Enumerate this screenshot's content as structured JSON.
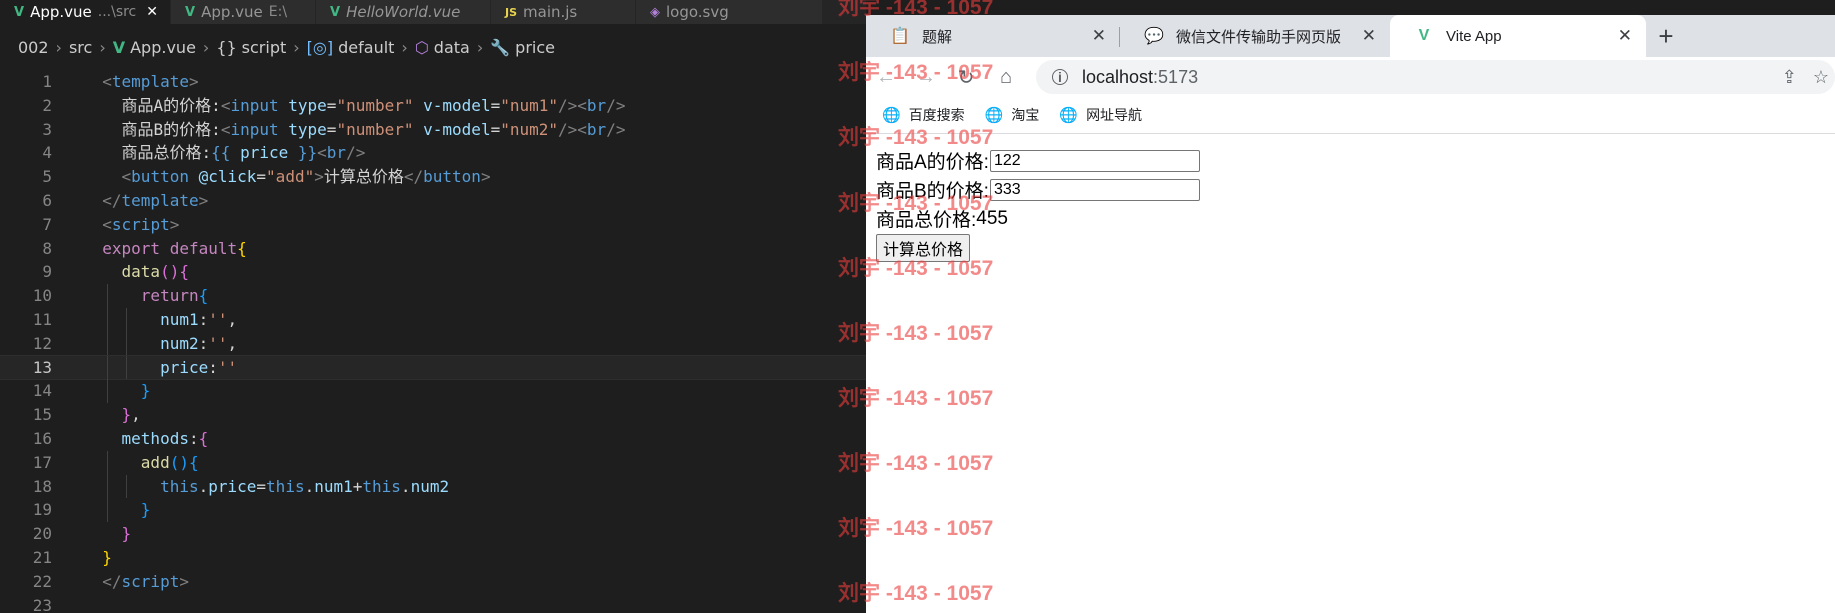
{
  "editor": {
    "tabs": [
      {
        "icon": "V",
        "label": "App.vue",
        "path": "...\\src",
        "active": true,
        "italic": false,
        "close": "✕"
      },
      {
        "icon": "V",
        "label": "App.vue",
        "path": "E:\\",
        "active": false,
        "italic": false
      },
      {
        "icon": "V",
        "label": "HelloWorld.vue",
        "path": "",
        "active": false,
        "italic": true
      },
      {
        "icon": "JS",
        "label": "main.js",
        "path": "",
        "active": false,
        "italic": false
      },
      {
        "icon": "◈",
        "label": "logo.svg",
        "path": "",
        "active": false,
        "italic": false
      }
    ],
    "breadcrumb": [
      "002",
      "src",
      "App.vue",
      "script",
      "default",
      "data",
      "price"
    ],
    "current_line": 13,
    "lines": [
      {
        "n": "1",
        "indent": 2,
        "tokens": [
          [
            "tag",
            "<"
          ],
          [
            "tagname",
            "template"
          ],
          [
            "tag",
            ">"
          ]
        ]
      },
      {
        "n": "2",
        "indent": 4,
        "tokens": [
          [
            "txt",
            "商品A的价格:"
          ],
          [
            "tag",
            "<"
          ],
          [
            "tagname",
            "input"
          ],
          [
            "txt",
            " "
          ],
          [
            "attr",
            "type"
          ],
          [
            "txt",
            "="
          ],
          [
            "str",
            "\"number\""
          ],
          [
            "txt",
            " "
          ],
          [
            "attr",
            "v-model"
          ],
          [
            "txt",
            "="
          ],
          [
            "str",
            "\"num1\""
          ],
          [
            "tag",
            "/><"
          ],
          [
            "tagname",
            "br"
          ],
          [
            "tag",
            "/>"
          ]
        ]
      },
      {
        "n": "3",
        "indent": 4,
        "tokens": [
          [
            "txt",
            "商品B的价格:"
          ],
          [
            "tag",
            "<"
          ],
          [
            "tagname",
            "input"
          ],
          [
            "txt",
            " "
          ],
          [
            "attr",
            "type"
          ],
          [
            "txt",
            "="
          ],
          [
            "str",
            "\"number\""
          ],
          [
            "txt",
            " "
          ],
          [
            "attr",
            "v-model"
          ],
          [
            "txt",
            "="
          ],
          [
            "str",
            "\"num2\""
          ],
          [
            "tag",
            "/><"
          ],
          [
            "tagname",
            "br"
          ],
          [
            "tag",
            "/>"
          ]
        ]
      },
      {
        "n": "4",
        "indent": 4,
        "tokens": [
          [
            "txt",
            "商品总价格:"
          ],
          [
            "kw2",
            "{{"
          ],
          [
            "txt",
            " "
          ],
          [
            "prop",
            "price"
          ],
          [
            "txt",
            " "
          ],
          [
            "kw2",
            "}}"
          ],
          [
            "tag",
            "<"
          ],
          [
            "tagname",
            "br"
          ],
          [
            "tag",
            "/>"
          ]
        ]
      },
      {
        "n": "5",
        "indent": 4,
        "tokens": [
          [
            "tag",
            "<"
          ],
          [
            "tagname",
            "button"
          ],
          [
            "txt",
            " "
          ],
          [
            "attr",
            "@click"
          ],
          [
            "txt",
            "="
          ],
          [
            "str",
            "\"add\""
          ],
          [
            "tag",
            ">"
          ],
          [
            "txt",
            "计算总价格"
          ],
          [
            "tag",
            "</"
          ],
          [
            "tagname",
            "button"
          ],
          [
            "tag",
            ">"
          ]
        ]
      },
      {
        "n": "6",
        "indent": 2,
        "tokens": [
          [
            "tag",
            "</"
          ],
          [
            "tagname",
            "template"
          ],
          [
            "tag",
            ">"
          ]
        ]
      },
      {
        "n": "7",
        "indent": 2,
        "tokens": [
          [
            "tag",
            "<"
          ],
          [
            "tagname",
            "script"
          ],
          [
            "tag",
            ">"
          ]
        ]
      },
      {
        "n": "8",
        "indent": 2,
        "tokens": [
          [
            "kw",
            "export"
          ],
          [
            "txt",
            " "
          ],
          [
            "kw",
            "default"
          ],
          [
            "b1",
            "{"
          ]
        ]
      },
      {
        "n": "9",
        "indent": 4,
        "tokens": [
          [
            "fn",
            "data"
          ],
          [
            "b2",
            "(){"
          ]
        ]
      },
      {
        "n": "10",
        "indent": 6,
        "tokens": [
          [
            "kw",
            "return"
          ],
          [
            "b3",
            "{"
          ]
        ]
      },
      {
        "n": "11",
        "indent": 8,
        "tokens": [
          [
            "prop",
            "num1"
          ],
          [
            "txt",
            ":"
          ],
          [
            "str",
            "''"
          ],
          [
            "txt",
            ","
          ]
        ]
      },
      {
        "n": "12",
        "indent": 8,
        "tokens": [
          [
            "prop",
            "num2"
          ],
          [
            "txt",
            ":"
          ],
          [
            "str",
            "''"
          ],
          [
            "txt",
            ","
          ]
        ]
      },
      {
        "n": "13",
        "indent": 8,
        "tokens": [
          [
            "prop",
            "price"
          ],
          [
            "txt",
            ":"
          ],
          [
            "str",
            "''"
          ]
        ]
      },
      {
        "n": "14",
        "indent": 6,
        "tokens": [
          [
            "b3",
            "}"
          ]
        ]
      },
      {
        "n": "15",
        "indent": 4,
        "tokens": [
          [
            "b2",
            "}"
          ],
          [
            "txt",
            ","
          ]
        ]
      },
      {
        "n": "16",
        "indent": 4,
        "tokens": [
          [
            "prop",
            "methods"
          ],
          [
            "txt",
            ":"
          ],
          [
            "b2",
            "{"
          ]
        ]
      },
      {
        "n": "17",
        "indent": 6,
        "tokens": [
          [
            "fn",
            "add"
          ],
          [
            "b3",
            "(){"
          ]
        ]
      },
      {
        "n": "18",
        "indent": 8,
        "tokens": [
          [
            "kw2",
            "this"
          ],
          [
            "txt",
            "."
          ],
          [
            "prop",
            "price"
          ],
          [
            "txt",
            "="
          ],
          [
            "kw2",
            "this"
          ],
          [
            "txt",
            "."
          ],
          [
            "prop",
            "num1"
          ],
          [
            "txt",
            "+"
          ],
          [
            "kw2",
            "this"
          ],
          [
            "txt",
            "."
          ],
          [
            "prop",
            "num2"
          ]
        ]
      },
      {
        "n": "19",
        "indent": 6,
        "tokens": [
          [
            "b3",
            "}"
          ]
        ]
      },
      {
        "n": "20",
        "indent": 4,
        "tokens": [
          [
            "b2",
            "}"
          ]
        ]
      },
      {
        "n": "21",
        "indent": 2,
        "tokens": [
          [
            "b1",
            "}"
          ]
        ]
      },
      {
        "n": "22",
        "indent": 2,
        "tokens": [
          [
            "tag",
            "</"
          ],
          [
            "tagname",
            "script"
          ],
          [
            "tag",
            ">"
          ]
        ]
      },
      {
        "n": "23",
        "indent": 0,
        "tokens": []
      }
    ]
  },
  "browser": {
    "tabs": [
      {
        "favicon": "📋",
        "label": "题解",
        "active": false
      },
      {
        "favicon": "💬",
        "label": "微信文件传输助手网页版",
        "active": false
      },
      {
        "favicon": "V",
        "label": "Vite App",
        "active": true
      }
    ],
    "new_tab": "+",
    "url_host": "localhost",
    "url_port": ":5173",
    "bookmarks": [
      "百度搜索",
      "淘宝",
      "网址导航"
    ],
    "page": {
      "label_a": "商品A的价格:",
      "value_a": "122",
      "label_b": "商品B的价格:",
      "value_b": "333",
      "total_label": "商品总价格:",
      "total_value": "455",
      "button_label": "计算总价格"
    }
  },
  "watermark": "刘宇 -143 - 1057",
  "colors": {
    "editor_bg": "#1e1e1e",
    "vue_green": "#41b883",
    "watermark": "#eb3c3c"
  }
}
